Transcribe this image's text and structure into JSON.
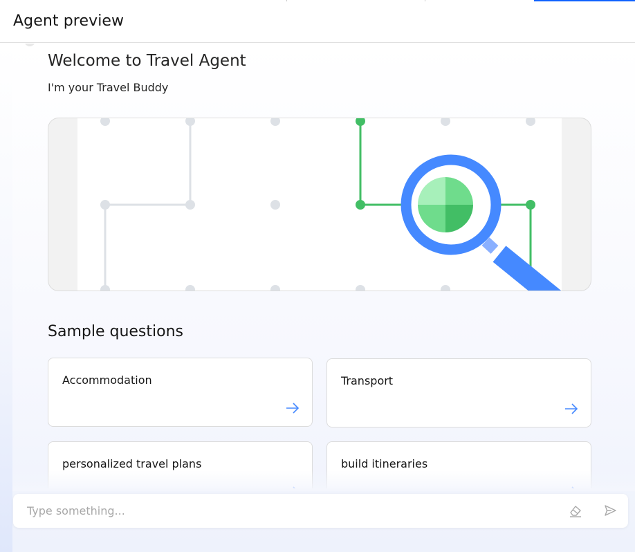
{
  "header": {
    "title": "Agent preview"
  },
  "welcome": {
    "title": "Welcome to Travel Agent",
    "subtitle": "I'm your Travel Buddy"
  },
  "hero": {
    "icon": "magnifier-network-illustration"
  },
  "samples": {
    "title": "Sample questions",
    "items": [
      {
        "label": "Accommodation",
        "icon": "arrow-right-icon"
      },
      {
        "label": "Transport",
        "icon": "arrow-right-icon"
      },
      {
        "label": "personalized travel plans",
        "icon": "arrow-right-icon"
      },
      {
        "label": "build itineraries",
        "icon": "arrow-right-icon"
      }
    ]
  },
  "input": {
    "placeholder": "Type something...",
    "value": ""
  },
  "colors": {
    "accent": "#0f62fe",
    "arrow": "#4589ff",
    "green": "#42be65",
    "magnifier": "#4589ff"
  }
}
